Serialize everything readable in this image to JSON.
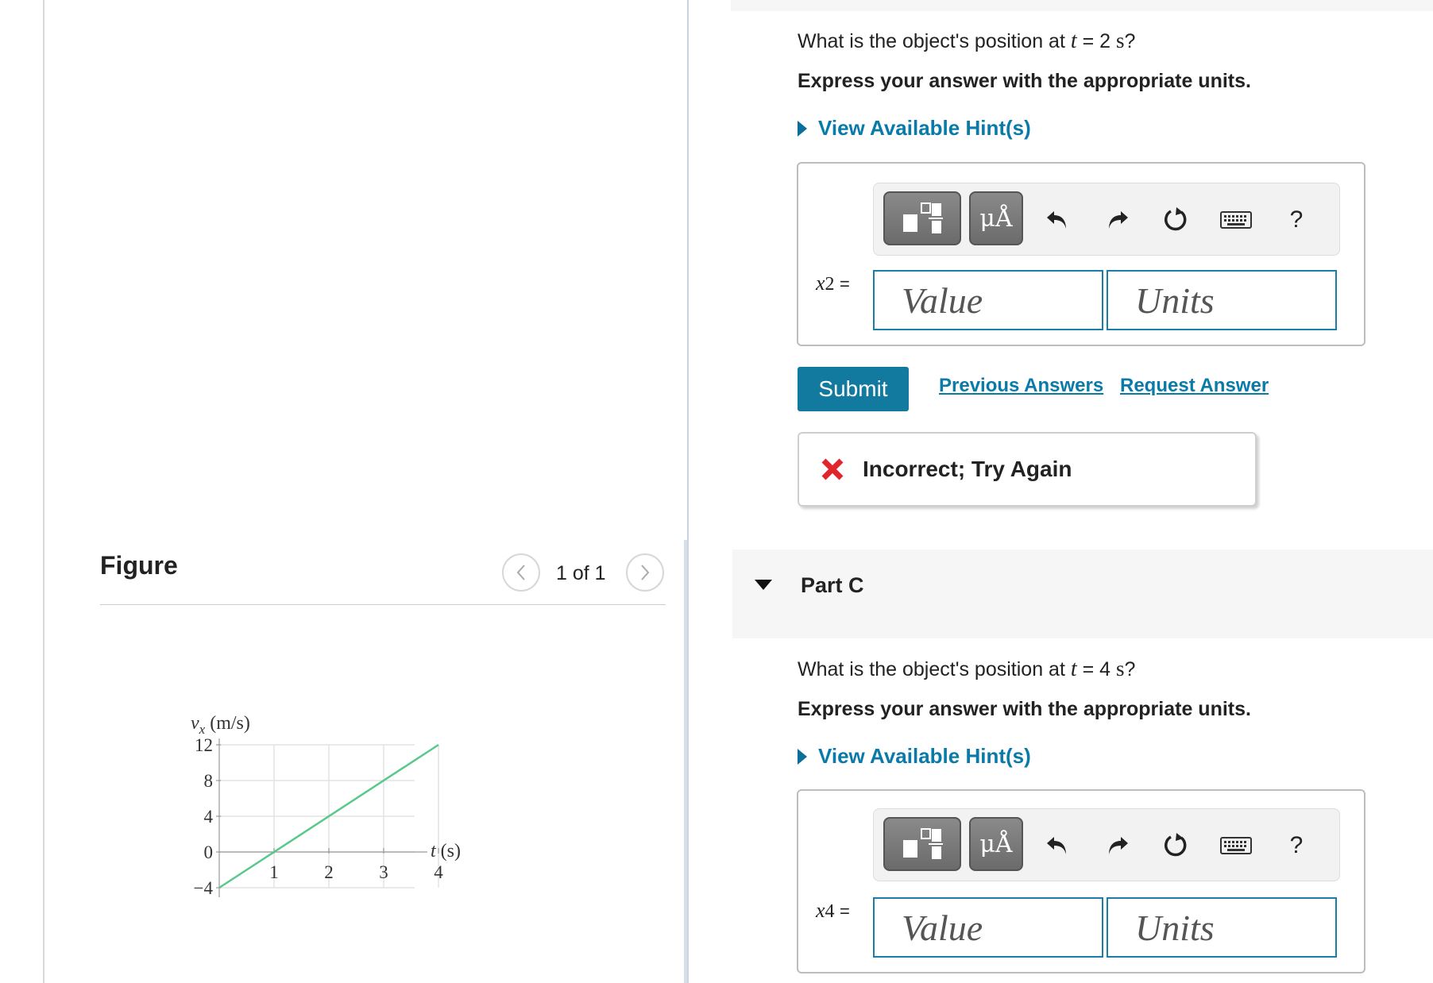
{
  "figure": {
    "title": "Figure",
    "pagination": "1 of 1",
    "prev_icon": "chevron-left-icon",
    "next_icon": "chevron-right-icon"
  },
  "chart_data": {
    "type": "line",
    "ylabel_var": "v",
    "ylabel_sub": "x",
    "ylabel_unit": "(m/s)",
    "xlabel_var": "t",
    "xlabel_unit": "(s)",
    "x_ticks": [
      "1",
      "2",
      "3",
      "4"
    ],
    "y_ticks": [
      "12",
      "8",
      "4",
      "0",
      "−4"
    ],
    "xlim": [
      0,
      4
    ],
    "ylim": [
      -4,
      12
    ],
    "grid": true,
    "line_color": "#58c98a",
    "series": [
      {
        "x": [
          0,
          4
        ],
        "y": [
          -4,
          12
        ]
      }
    ]
  },
  "part_b": {
    "question_prefix": "What is the object's position at ",
    "question_var": "t",
    "question_eq": " = 2 ",
    "question_unit": "s",
    "question_suffix": "?",
    "instruction": "Express your answer with the appropriate units.",
    "hint_label": "View Available Hint(s)",
    "var_name": "x",
    "var_sub": "2",
    "var_eq": "=",
    "value_placeholder": "Value",
    "units_placeholder": "Units",
    "submit_label": "Submit",
    "previous_answers": "Previous Answers",
    "request_answer": "Request Answer",
    "feedback": "Incorrect; Try Again"
  },
  "toolbar": {
    "template_icon": "fraction-template-icon",
    "symbol_label": "μÅ",
    "undo_icon": "undo-icon",
    "redo_icon": "redo-icon",
    "reset_icon": "reset-icon",
    "keyboard_icon": "keyboard-icon",
    "help_label": "?"
  },
  "part_c": {
    "title": "Part C",
    "question_prefix": "What is the object's position at ",
    "question_var": "t",
    "question_eq": " = 4 ",
    "question_unit": "s",
    "question_suffix": "?",
    "instruction": "Express your answer with the appropriate units.",
    "hint_label": "View Available Hint(s)",
    "var_name": "x",
    "var_sub": "4",
    "var_eq": "=",
    "value_placeholder": "Value",
    "units_placeholder": "Units"
  },
  "colors": {
    "accent": "#12799f",
    "link": "#0a7aa8",
    "error": "#e0262c",
    "input_border": "#1a7fa8"
  }
}
